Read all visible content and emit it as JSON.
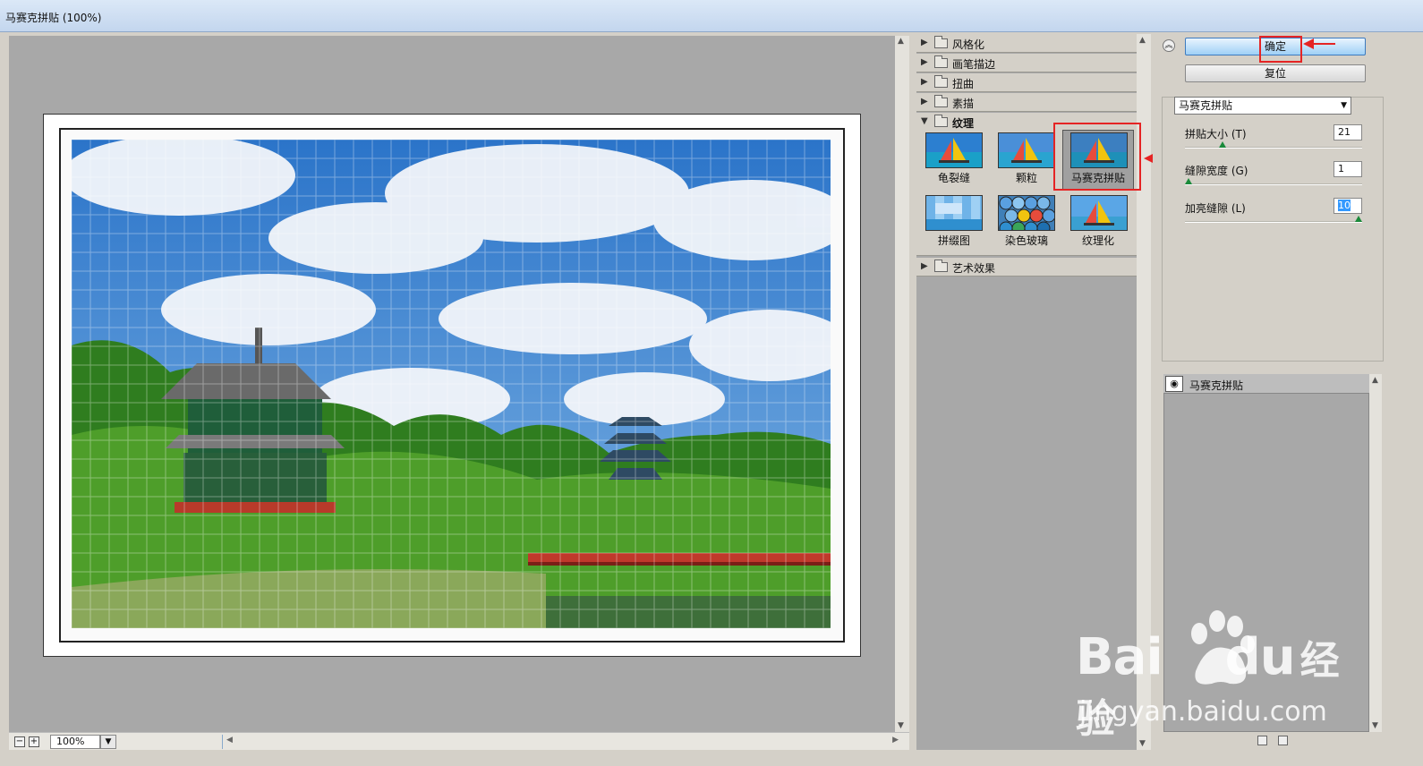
{
  "window": {
    "title": "马赛克拼贴 (100%)"
  },
  "status": {
    "zoom": "100%"
  },
  "gallery": {
    "categories": [
      {
        "label": "风格化"
      },
      {
        "label": "画笔描边"
      },
      {
        "label": "扭曲"
      },
      {
        "label": "素描"
      },
      {
        "label": "纹理"
      },
      {
        "label": "艺术效果"
      }
    ],
    "texture_filters": [
      {
        "label": "龟裂缝"
      },
      {
        "label": "颗粒"
      },
      {
        "label": "马赛克拼贴"
      },
      {
        "label": "拼缀图"
      },
      {
        "label": "染色玻璃"
      },
      {
        "label": "纹理化"
      }
    ]
  },
  "panel": {
    "ok_label": "确定",
    "reset_label": "复位",
    "filter_select": "马赛克拼贴",
    "params": [
      {
        "label": "拼贴大小 (T)",
        "value": "21",
        "fraction": 0.2
      },
      {
        "label": "缝隙宽度 (G)",
        "value": "1",
        "fraction": 0.0
      },
      {
        "label": "加亮缝隙 (L)",
        "value": "10",
        "fraction": 1.0
      }
    ],
    "layer_name": "马赛克拼贴"
  },
  "watermark": {
    "main": "Bai",
    "du": "du",
    "cn": "经验",
    "sub": "jingyan.baidu.com"
  },
  "colors": {
    "highlight_red": "#e52424",
    "slider_green": "#1a8a3a",
    "selection_blue": "#3399ff"
  }
}
